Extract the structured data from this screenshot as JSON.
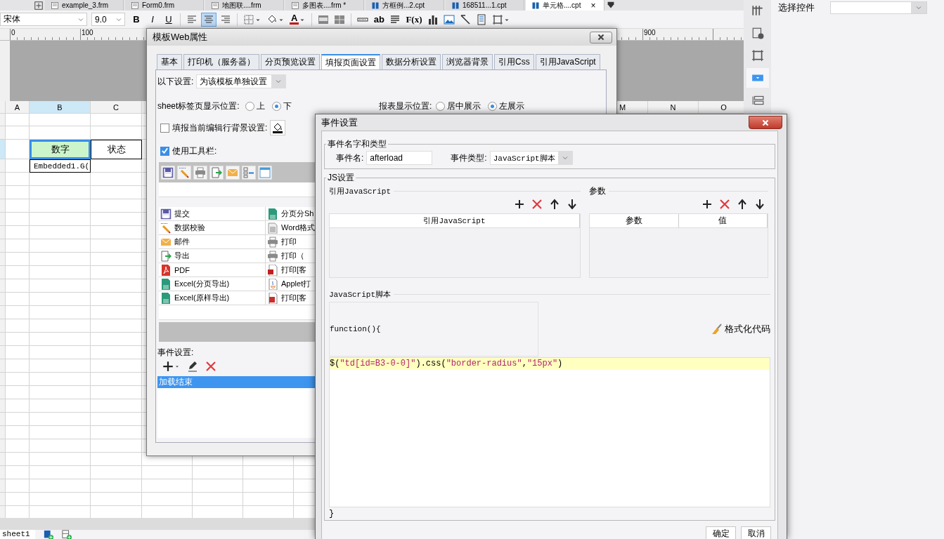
{
  "file_tabs": [
    {
      "label": "example_3.frm",
      "kind": "form",
      "selected": false
    },
    {
      "label": "Form0.frm",
      "kind": "form",
      "selected": false
    },
    {
      "label": "地图联....frm",
      "kind": "form",
      "selected": false
    },
    {
      "label": "多图表....frm *",
      "kind": "form",
      "selected": false
    },
    {
      "label": "方框例...2.cpt",
      "kind": "report",
      "selected": false
    },
    {
      "label": "168511...1.cpt",
      "kind": "report",
      "selected": false
    },
    {
      "label": "单元格....cpt",
      "kind": "report",
      "selected": true,
      "close": "×"
    }
  ],
  "toolbar": {
    "font": "宋体",
    "font_size": "9.0",
    "style_buttons": [
      "B",
      "I",
      "U"
    ],
    "align_buttons": [
      {
        "kind": "left",
        "selected": false
      },
      {
        "kind": "center",
        "selected": true
      },
      {
        "kind": "right",
        "selected": false
      }
    ],
    "font_color": "A",
    "text_button": "ab",
    "formula_button": "F(x)"
  },
  "ruler_labels": [
    "0",
    "100",
    "900"
  ],
  "sheet": {
    "columns": [
      {
        "label": "A",
        "selected": false
      },
      {
        "label": "B",
        "selected": true
      },
      {
        "label": "C",
        "selected": false
      },
      {
        "label": "M",
        "selected": false
      },
      {
        "label": "N",
        "selected": false
      },
      {
        "label": "O",
        "selected": false
      }
    ],
    "cells": [
      {
        "text": "数字",
        "selected": true
      },
      {
        "text": "状态",
        "selected": false
      },
      {
        "text": "Embedded1.G(",
        "selected": false
      }
    ],
    "sheet_tabs": [
      {
        "label": "sheet1",
        "selected": true
      }
    ]
  },
  "side_tools": [
    {
      "selected": false
    },
    {
      "selected": false
    },
    {
      "selected": false
    },
    {
      "selected": true
    },
    {
      "selected": false
    }
  ],
  "side_panel": {
    "label": "选择控件"
  },
  "web_dialog": {
    "title": "模板Web属性",
    "tabs": [
      {
        "label": "基本",
        "selected": false
      },
      {
        "label": "打印机（服务器）",
        "selected": false
      },
      {
        "label": "分页预览设置",
        "selected": false
      },
      {
        "label": "填报页面设置",
        "selected": true
      },
      {
        "label": "数据分析设置",
        "selected": false
      },
      {
        "label": "浏览器背景",
        "selected": false
      },
      {
        "label": "引用Css",
        "selected": false
      },
      {
        "label": "引用JavaScript",
        "selected": false
      }
    ],
    "scope_label": "以下设置:",
    "scope_value": "为该模板单独设置",
    "sheet_tab_label": "sheet标签页显示位置:",
    "sheet_tab_options": [
      {
        "label": "上",
        "selected": false
      },
      {
        "label": "下",
        "selected": true
      }
    ],
    "report_pos_label": "报表显示位置:",
    "report_pos_options": [
      {
        "label": "居中展示",
        "selected": false
      },
      {
        "label": "左展示",
        "selected": true
      }
    ],
    "row_bg": {
      "label": "填报当前编辑行背景设置:",
      "checked": false
    },
    "use_toolbar": {
      "label": "使用工具栏:",
      "checked": true
    },
    "buttons_left": [
      "提交",
      "数据校验",
      "邮件",
      "导出",
      "PDF",
      "Excel(分页导出)",
      "Excel(原样导出)"
    ],
    "buttons_right": [
      "分页分Sh",
      "Word格式",
      "打印",
      "打印（",
      "打印[客",
      "Applet打",
      "打印[客"
    ],
    "event_label": "事件设置:",
    "events": [
      {
        "label": "加载结束",
        "selected": true
      }
    ]
  },
  "event_dialog": {
    "title": "事件设置",
    "name_group": "事件名字和类型",
    "name_label": "事件名:",
    "name_value": "afterload",
    "type_label": "事件类型:",
    "type_value": "JavaScript脚本",
    "js_group": "JS设置",
    "ref_section": "引用JavaScript",
    "ref_column": "引用JavaScript",
    "param_section": "参数",
    "param_columns": [
      "参数",
      "值"
    ],
    "script_label": "JavaScript脚本",
    "script_header": "function(){",
    "format_button": "格式化代码",
    "script_lines": [
      {
        "highlighted": true,
        "tokens": [
          {
            "text": "$(",
            "kind": "plain"
          },
          {
            "text": "\"td[id=B3-0-0]\"",
            "kind": "string"
          },
          {
            "text": ").css(",
            "kind": "plain"
          },
          {
            "text": "\"border-radius\"",
            "kind": "string"
          },
          {
            "text": ",",
            "kind": "plain"
          },
          {
            "text": "\"15px\"",
            "kind": "string"
          },
          {
            "text": ")",
            "kind": "plain"
          }
        ]
      }
    ],
    "script_footer": "}",
    "buttons": [
      "确定",
      "取消"
    ]
  }
}
